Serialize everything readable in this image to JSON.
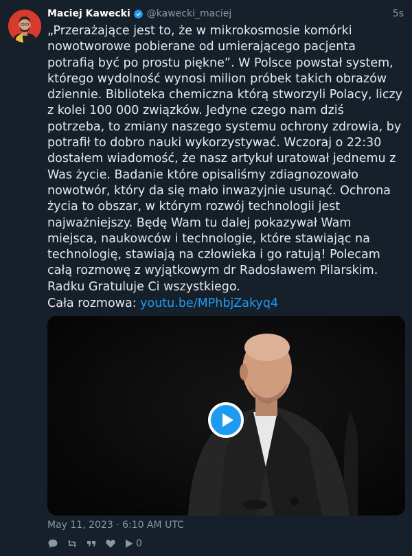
{
  "author": {
    "name": "Maciej Kawecki",
    "handle": "@kawecki_maciej",
    "verified_icon": "verified-badge-icon",
    "time": "5s"
  },
  "tweet": {
    "text": "„Przerażające jest to, że w mikrokosmosie komórki nowotworowe pobierane od umierającego pacjenta potrafią być po prostu piękne”. W Polsce powstał system, którego wydolność wynosi milion próbek takich obrazów dziennie. Biblioteka chemiczna którą stworzyli Polacy, liczy z kolei 100 000 związków. Jedyne czego nam dziś potrzeba, to zmiany naszego systemu ochrony zdrowia, by potrafił to dobro nauki wykorzystywać. Wczoraj o 22:30 dostałem wiadomość, że nasz artykuł uratował jednemu z Was życie. Badanie które opisaliśmy zdiagnozowało nowotwór, który da się mało inwazyjnie usunąć. Ochrona życia to obszar, w którym rozwój technologii jest najważniejszy. Będę Wam tu dalej pokazywał Wam miejsca, naukowców i technologie, które stawiając na technologię, stawiają na człowieka i go ratują! Polecam całą rozmowę z wyjątkowym dr Radosławem Pilarskim. Radku Gratuluje Ci wszystkiego.",
    "cta_label": "Cała rozmowa: ",
    "cta_link": "youtu.be/MPhbjZakyq4"
  },
  "media": {
    "type": "video",
    "play_icon": "play-icon"
  },
  "meta": {
    "date": "May 11, 2023 · 6:10 AM UTC"
  },
  "actions": {
    "reply_icon": "reply-icon",
    "retweet_icon": "retweet-icon",
    "quote_icon": "quote-icon",
    "like_icon": "heart-icon",
    "views_icon": "play-icon",
    "views_count": "0"
  },
  "colors": {
    "background": "#15202b",
    "link": "#1d9bf0",
    "muted": "#8899a6"
  }
}
